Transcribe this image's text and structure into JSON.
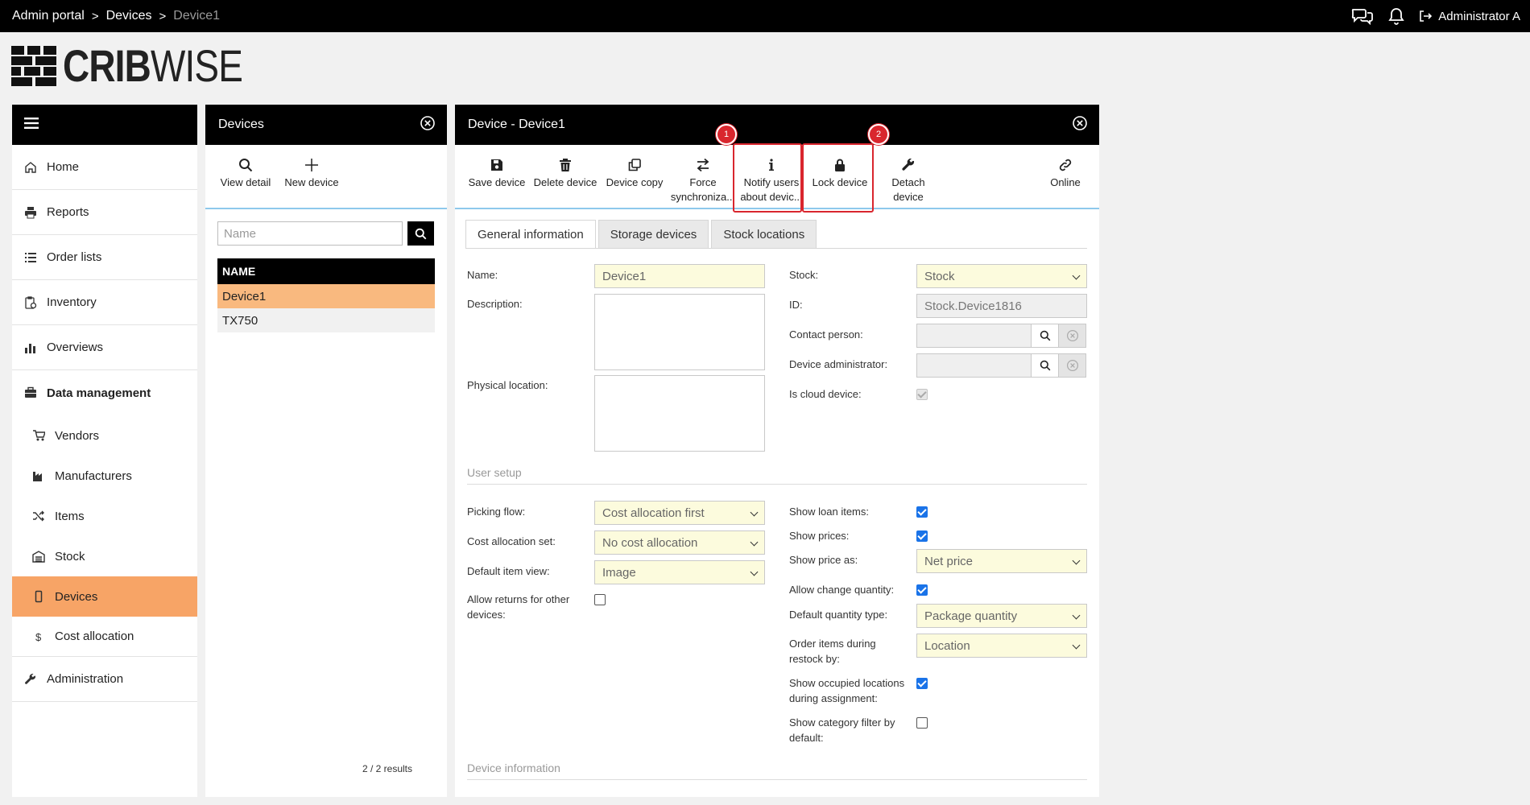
{
  "breadcrumb": {
    "root": "Admin portal",
    "sep": ">",
    "level1": "Devices",
    "current": "Device1"
  },
  "header": {
    "user": "Administrator A"
  },
  "logo": {
    "bold": "CRIB",
    "light": "WISE"
  },
  "nav": {
    "items": [
      {
        "label": "Home",
        "icon": "home-icon"
      },
      {
        "label": "Reports",
        "icon": "printer-icon"
      },
      {
        "label": "Order lists",
        "icon": "list-icon"
      },
      {
        "label": "Inventory",
        "icon": "clipboard-icon"
      },
      {
        "label": "Overviews",
        "icon": "bar-chart-icon"
      },
      {
        "label": "Data management",
        "icon": "briefcase-icon"
      }
    ],
    "sub": [
      {
        "label": "Vendors",
        "icon": "cart-icon"
      },
      {
        "label": "Manufacturers",
        "icon": "factory-icon"
      },
      {
        "label": "Items",
        "icon": "shuffle-icon"
      },
      {
        "label": "Stock",
        "icon": "warehouse-icon"
      },
      {
        "label": "Devices",
        "icon": "mobile-icon",
        "active": true
      },
      {
        "label": "Cost allocation",
        "icon": "dollar-icon"
      }
    ],
    "admin": {
      "label": "Administration",
      "icon": "wrench-icon"
    }
  },
  "devices_panel": {
    "title": "Devices",
    "toolbar": {
      "view_detail": "View detail",
      "new_device": "New device"
    },
    "search_placeholder": "Name",
    "column": "NAME",
    "rows": [
      "Device1",
      "TX750"
    ],
    "results": "2 / 2 results"
  },
  "detail_panel": {
    "title": "Device - Device1",
    "toolbar": {
      "save": "Save device",
      "delete": "Delete device",
      "copy": "Device copy",
      "force_1": "Force",
      "force_2": "synchroniza...",
      "notify_1": "Notify users",
      "notify_2": "about devic...",
      "lock": "Lock device",
      "detach_1": "Detach",
      "detach_2": "device",
      "online": "Online"
    },
    "callouts": [
      "1",
      "2"
    ],
    "tabs": [
      "General information",
      "Storage devices",
      "Stock locations"
    ],
    "general": {
      "name_label": "Name:",
      "name_value": "Device1",
      "description_label": "Description:",
      "physical_location_label": "Physical location:",
      "stock_label": "Stock:",
      "stock_value": "Stock",
      "id_label": "ID:",
      "id_value": "Stock.Device1816",
      "contact_label": "Contact person:",
      "admin_label": "Device administrator:",
      "cloud_label": "Is cloud device:"
    },
    "user_setup": {
      "section": "User setup",
      "picking_flow_label": "Picking flow:",
      "picking_flow_value": "Cost allocation first",
      "cost_set_label": "Cost allocation set:",
      "cost_set_value": "No cost allocation",
      "item_view_label": "Default item view:",
      "item_view_value": "Image",
      "returns_label_1": "Allow returns for other",
      "returns_label_2": "devices:",
      "loan_label": "Show loan items:",
      "prices_label": "Show prices:",
      "price_as_label": "Show price as:",
      "price_as_value": "Net price",
      "change_qty_label": "Allow change quantity:",
      "qty_type_label": "Default quantity type:",
      "qty_type_value": "Package quantity",
      "order_items_label_1": "Order items during",
      "order_items_label_2": "restock by:",
      "order_items_value": "Location",
      "occupied_label_1": "Show occupied locations",
      "occupied_label_2": "during assignment:",
      "category_label_1": "Show category filter by",
      "category_label_2": "default:"
    },
    "device_info": {
      "section": "Device information"
    },
    "checkbox_states": {
      "is_cloud_device": true,
      "allow_returns": false,
      "show_loan_items": true,
      "show_prices": true,
      "allow_change_quantity": true,
      "show_occupied_locations": true,
      "show_category_filter": false
    }
  },
  "colors": {
    "active_nav": "#f7a466",
    "selected_row": "#f9b97f",
    "callout": "#d9262e",
    "field_yellow": "#fcfbdd",
    "toolbar_line": "#8ec9ec"
  }
}
